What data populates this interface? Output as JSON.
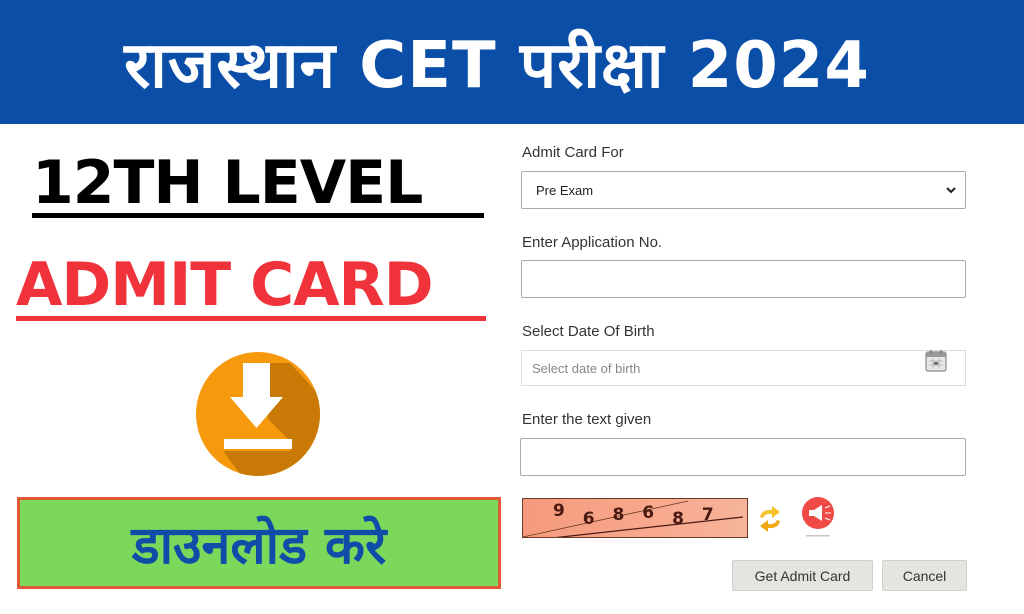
{
  "banner": {
    "title": "राजस्थान CET परीक्षा 2024",
    "background": "#0a4ea8"
  },
  "left_panel": {
    "level_title": "12TH LEVEL",
    "admit_title": "ADMIT CARD",
    "download_icon": "download-circle-icon",
    "download_button_label": "डाउनलोड करे",
    "colors": {
      "admit_title": "#f0323a",
      "download_button_bg": "#7cd85a",
      "download_button_text": "#0e4ea8",
      "download_icon": "#f59a0c"
    }
  },
  "form": {
    "admit_card_for": {
      "label": "Admit Card For",
      "selected": "Pre Exam"
    },
    "application_no": {
      "label": "Enter Application No.",
      "value": ""
    },
    "dob": {
      "label": "Select Date Of Birth",
      "placeholder": "Select date of birth",
      "icon": "calendar-icon"
    },
    "captcha_input": {
      "label": "Enter the text given",
      "value": ""
    },
    "captcha": {
      "digits": [
        "9",
        "6",
        "8",
        "6",
        "8",
        "7"
      ],
      "refresh_icon": "refresh-icon",
      "audio_icon": "audio-captcha-icon"
    },
    "buttons": {
      "submit": "Get Admit Card",
      "cancel": "Cancel"
    }
  }
}
